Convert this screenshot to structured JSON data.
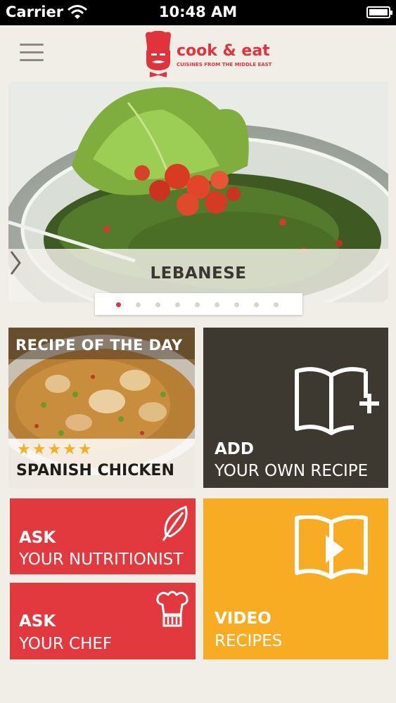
{
  "status_bar": {
    "carrier": "Carrier",
    "time": "10:48 AM"
  },
  "header": {
    "logo_name": "cook & eat",
    "logo_tagline": "CUISINES FROM THE MIDDLE EAST"
  },
  "carousel": {
    "title": "LEBANESE",
    "slide_count": 9,
    "active_slide": 1
  },
  "recipe_of_the_day": {
    "heading": "RECIPE OF THE DAY",
    "rating_stars": 5,
    "rating_text": "★★★★★",
    "name": "SPANISH CHICKEN"
  },
  "tiles": {
    "add": {
      "line1": "ADD",
      "line2": "YOUR OWN RECIPE"
    },
    "nutritionist": {
      "line1": "ASK",
      "line2": "YOUR NUTRITIONIST"
    },
    "chef": {
      "line1": "ASK",
      "line2": "YOUR CHEF"
    },
    "video": {
      "line1": "VIDEO",
      "line2": "RECIPES"
    }
  },
  "icons": {
    "menu": "hamburger-menu-icon",
    "logo": "chef-mascot-icon",
    "next": "chevron-right-icon",
    "add": "book-plus-icon",
    "nutritionist": "leaf-icon",
    "chef": "chef-hat-icon",
    "video": "book-play-icon"
  },
  "colors": {
    "brand_red": "#e0333c",
    "tile_dark": "#3d3830",
    "tile_red": "#e2393f",
    "tile_yellow": "#f8ac24",
    "star": "#f4b022",
    "background": "#f1ede7"
  }
}
